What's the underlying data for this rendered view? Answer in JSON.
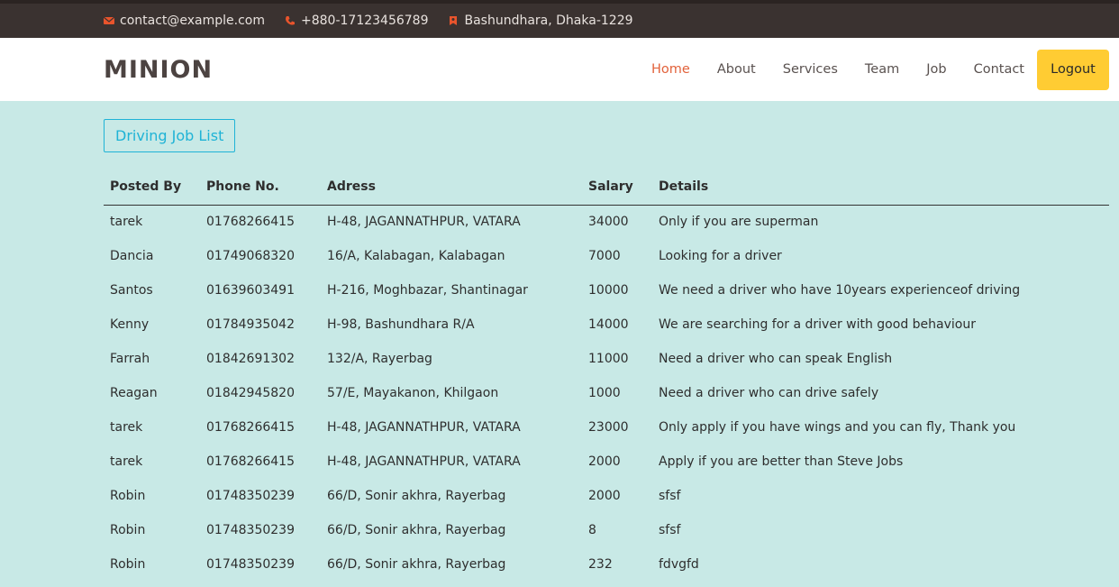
{
  "topbar": {
    "email": "contact@example.com",
    "phone": "+880-17123456789",
    "address": "Bashundhara, Dhaka-1229",
    "icons": [
      "envelope-icon",
      "phone-icon",
      "map-marker-icon"
    ],
    "icon_color": "#e8542c"
  },
  "header": {
    "logo": "MINION",
    "nav": [
      "Home",
      "About",
      "Services",
      "Team",
      "Job",
      "Contact"
    ],
    "active": "Home",
    "logout": "Logout",
    "logout_color": "#ffcc33"
  },
  "page": {
    "title": "Driving Job List",
    "title_color": "#1fb3d6",
    "background": "#c8e9e6"
  },
  "table": {
    "headers": [
      "Posted By",
      "Phone No.",
      "Adress",
      "Salary",
      "Details"
    ],
    "rows": [
      [
        "tarek",
        "01768266415",
        "H-48, JAGANNATHPUR, VATARA",
        "34000",
        "Only if you are superman"
      ],
      [
        "Dancia",
        "01749068320",
        "16/A, Kalabagan, Kalabagan",
        "7000",
        "Looking for a driver"
      ],
      [
        "Santos",
        "01639603491",
        "H-216, Moghbazar, Shantinagar",
        "10000",
        "We need a driver who have 10years experienceof driving"
      ],
      [
        "Kenny",
        "01784935042",
        "H-98, Bashundhara R/A",
        "14000",
        "We are searching for a driver with good behaviour"
      ],
      [
        "Farrah",
        "01842691302",
        "132/A, Rayerbag",
        "11000",
        "Need a driver who can speak English"
      ],
      [
        "Reagan",
        "01842945820",
        "57/E, Mayakanon, Khilgaon",
        "1000",
        "Need a driver who can drive safely"
      ],
      [
        "tarek",
        "01768266415",
        "H-48, JAGANNATHPUR, VATARA",
        "23000",
        "Only apply if you have wings and you can fly, Thank you"
      ],
      [
        "tarek",
        "01768266415",
        "H-48, JAGANNATHPUR, VATARA",
        "2000",
        "Apply if you are better than Steve Jobs"
      ],
      [
        "Robin",
        "01748350239",
        "66/D, Sonir akhra, Rayerbag",
        "2000",
        "sfsf"
      ],
      [
        "Robin",
        "01748350239",
        "66/D, Sonir akhra, Rayerbag",
        "8",
        "sfsf"
      ],
      [
        "Robin",
        "01748350239",
        "66/D, Sonir akhra, Rayerbag",
        "232",
        "fdvgfd"
      ]
    ]
  }
}
